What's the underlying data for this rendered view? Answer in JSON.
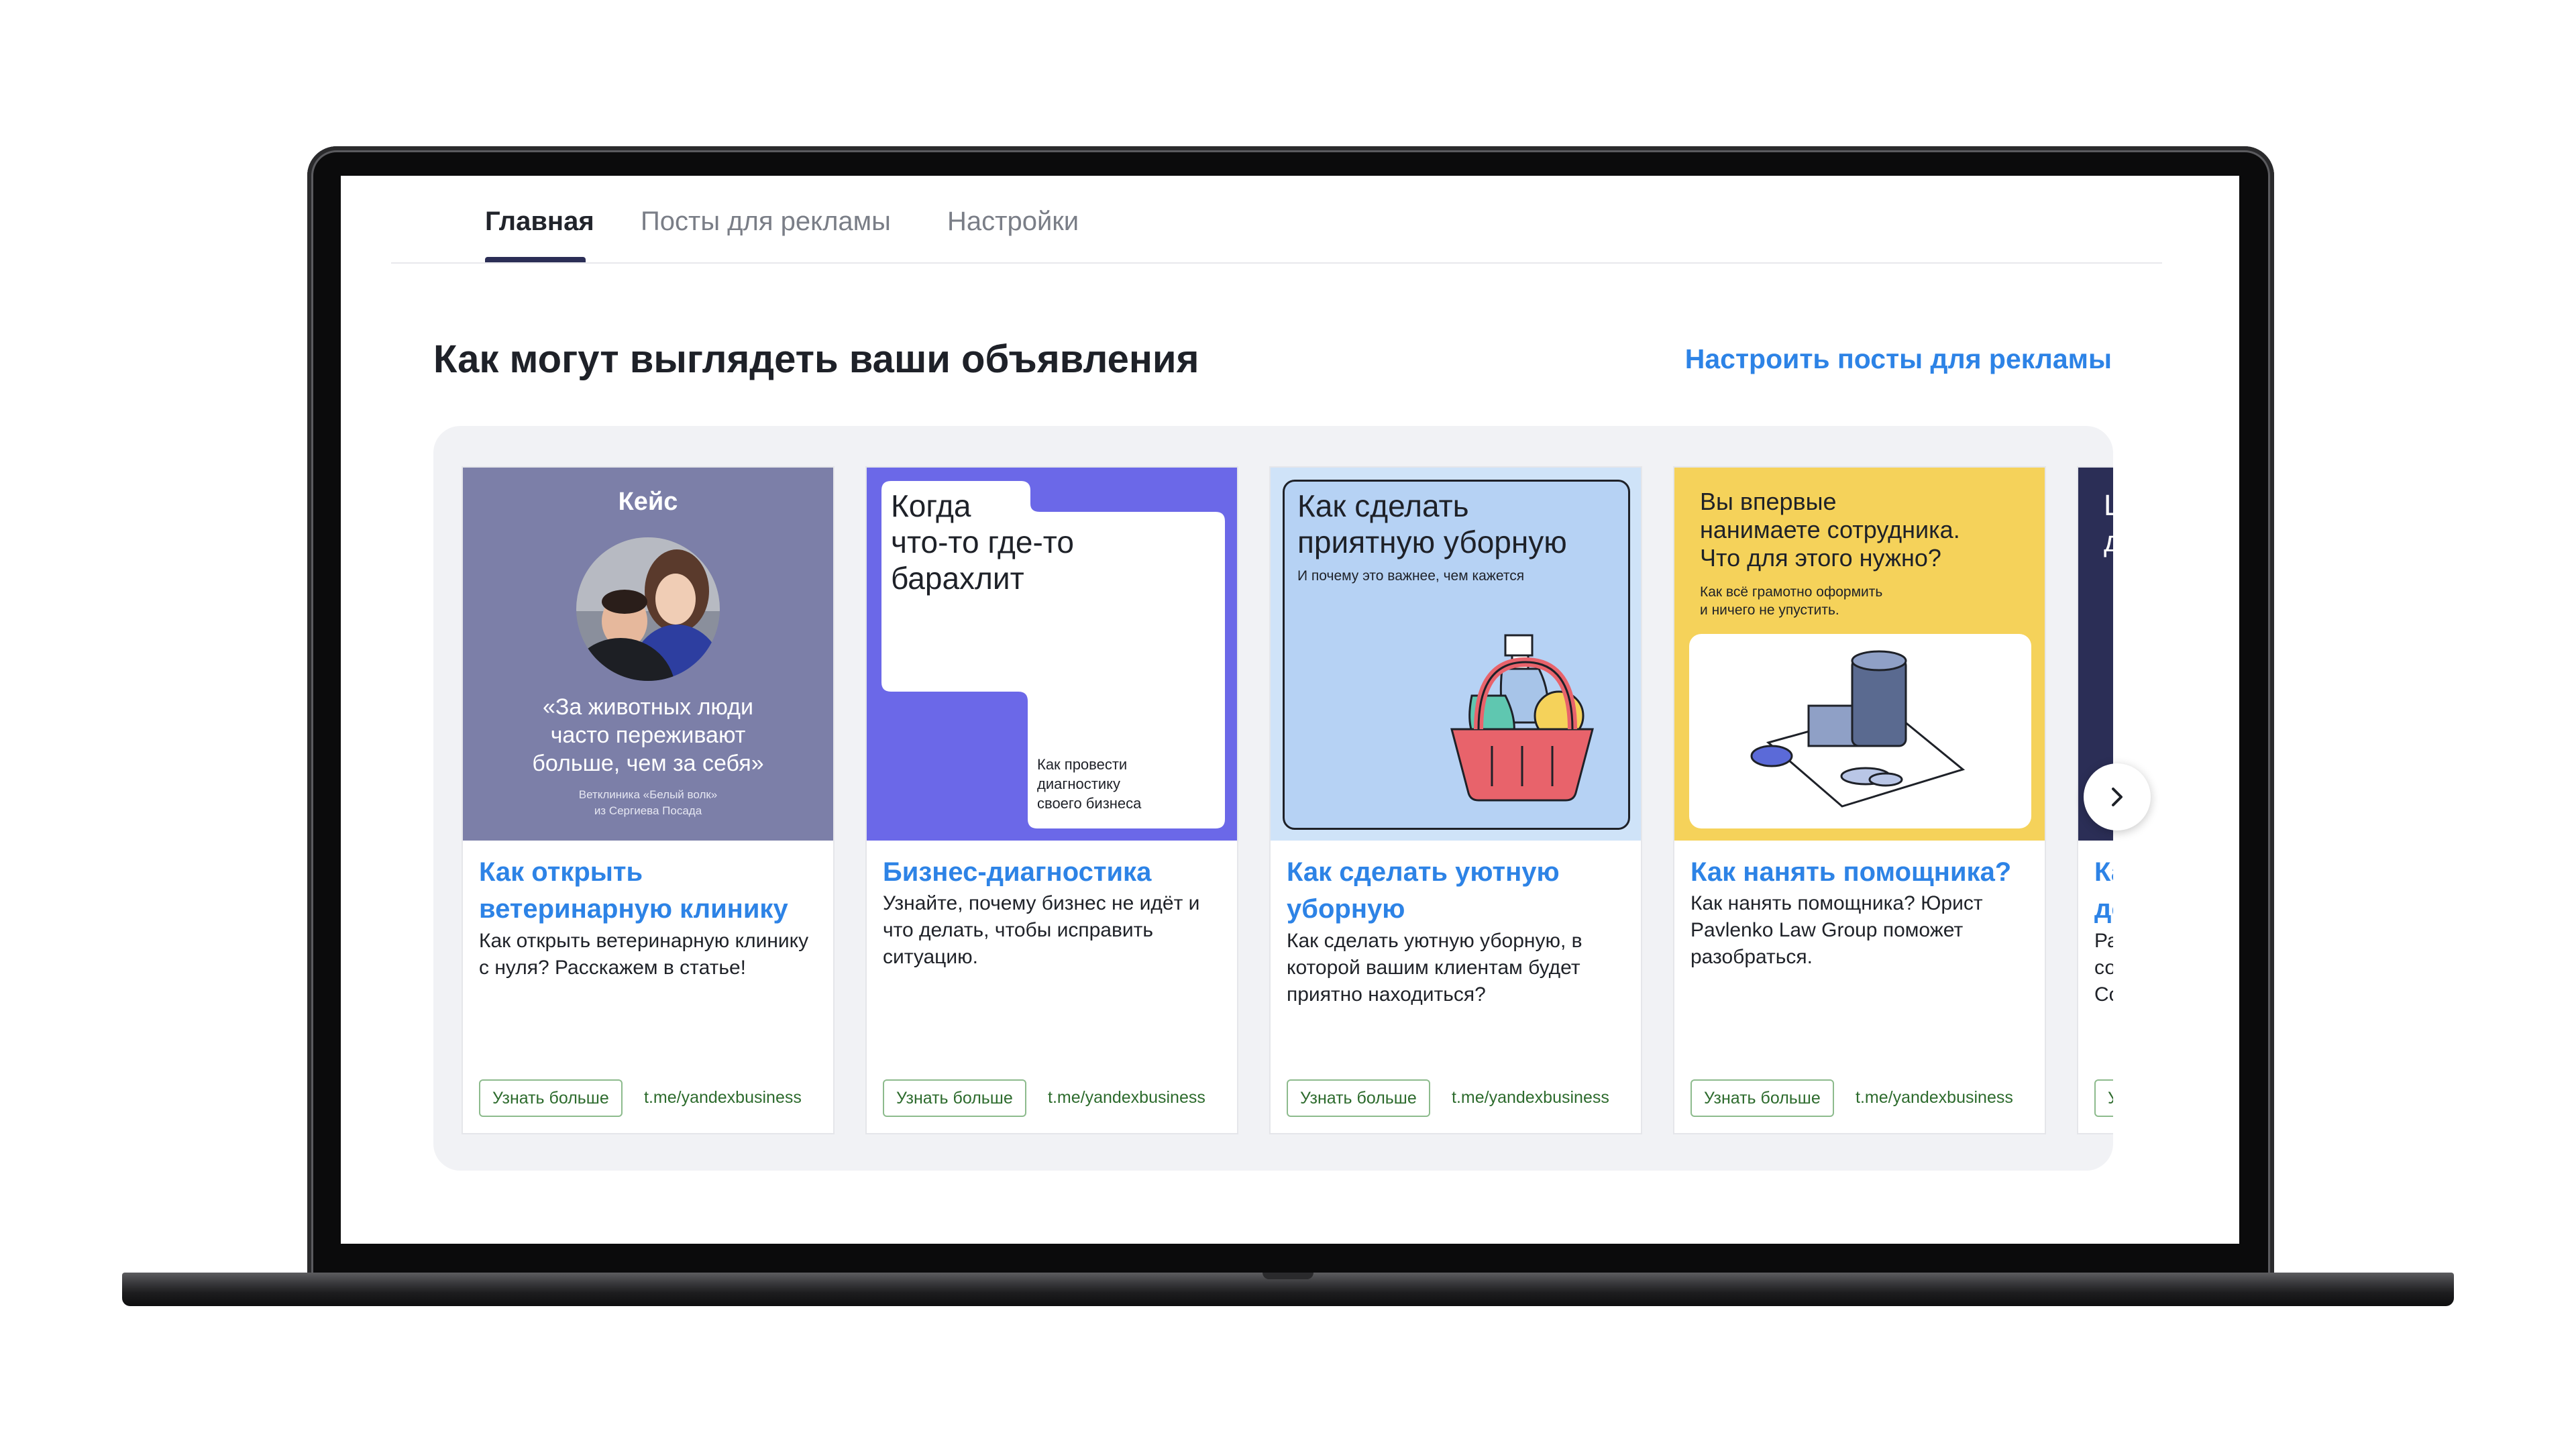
{
  "tabs": [
    {
      "label": "Главная",
      "active": true
    },
    {
      "label": "Посты для рекламы",
      "active": false
    },
    {
      "label": "Настройки",
      "active": false
    }
  ],
  "section": {
    "title": "Как могут выглядеть ваши объявления",
    "setup_link": "Настроить посты для рекламы"
  },
  "colors": {
    "link": "#2d83e6",
    "card1_bg": "#7c7fa8",
    "card2_bg": "#6b68e8",
    "card3_bg": "#b6d2f4",
    "card4_bg": "#f5d25a",
    "card5_bg": "#2b2e56",
    "button_green": "#2d6b2d"
  },
  "cards": [
    {
      "image": {
        "heading": "Кейс",
        "quote": [
          "«За животных люди",
          "часто переживают",
          "больше, чем за себя»"
        ],
        "caption": [
          "Ветклиника «Белый волк»",
          "из Сергиева Посада"
        ]
      },
      "title": "Как открыть ветеринарную клинику",
      "desc": "Как открыть ветеринарную клинику с нуля? Расскажем в статье!",
      "button": "Узнать больше",
      "url": "t.me/yandexbusiness"
    },
    {
      "image": {
        "heading": [
          "Когда",
          "что-то где-то",
          "барахлит"
        ],
        "caption": [
          "Как провести",
          "диагностику",
          "своего бизнеса"
        ]
      },
      "title": "Бизнес-диагностика",
      "desc": "Узнайте, почему бизнес не идёт и что делать, чтобы исправить ситуацию.",
      "button": "Узнать больше",
      "url": "t.me/yandexbusiness"
    },
    {
      "image": {
        "heading": [
          "Как сделать",
          "приятную уборную"
        ],
        "caption": "И почему это важнее, чем кажется"
      },
      "title": "Как сделать уютную уборную",
      "desc": "Как сделать уютную уборную, в которой вашим клиентам будет приятно находиться?",
      "button": "Узнать больше",
      "url": "t.me/yandexbusiness"
    },
    {
      "image": {
        "heading": [
          "Вы впервые",
          "нанимаете сотрудника.",
          "Что для этого нужно?"
        ],
        "caption": [
          "Как всё грамотно оформить",
          "и ничего не упустить."
        ]
      },
      "title": "Как нанять помощника?",
      "desc": "Как нанять помощника? Юрист Pavlenko Law Group поможет разобраться.",
      "button": "Узнать больше",
      "url": "t.me/yandexbusiness"
    },
    {
      "image": {
        "heading": [
          "Ц",
          "д"
        ]
      },
      "title": [
        "Ка",
        "до"
      ],
      "desc": [
        "Ра",
        "со",
        "Со"
      ],
      "button": "У"
    }
  ],
  "icons": {
    "next": "chevron-right-icon"
  }
}
